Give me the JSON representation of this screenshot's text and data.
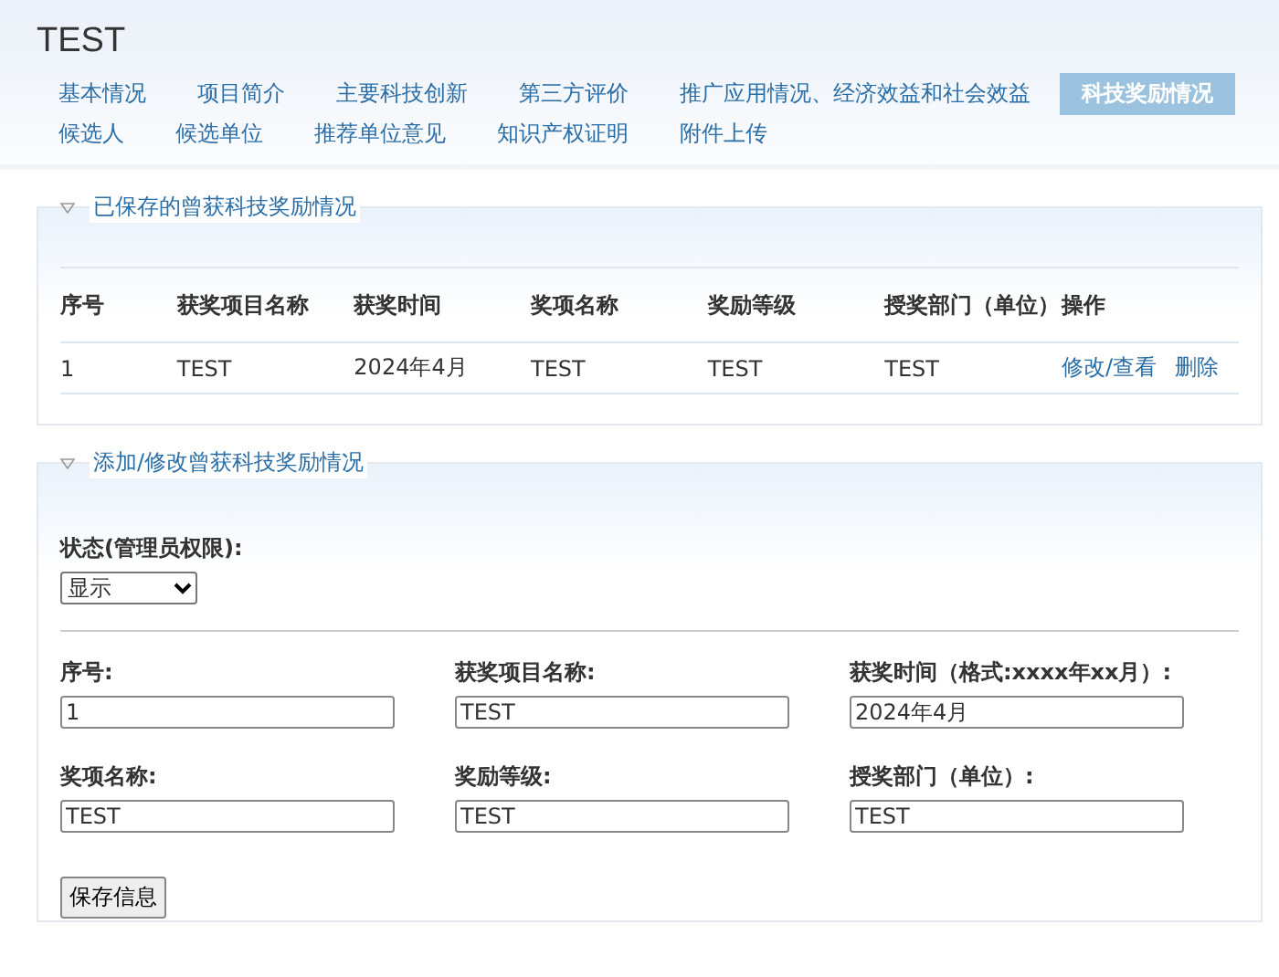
{
  "title": "TEST",
  "tabs": [
    [
      {
        "label": "基本情况",
        "selected": false
      },
      {
        "label": "项目简介",
        "selected": false
      },
      {
        "label": "主要科技创新",
        "selected": false
      },
      {
        "label": "第三方评价",
        "selected": false
      },
      {
        "label": "推广应用情况、经济效益和社会效益",
        "selected": false
      },
      {
        "label": "科技奖励情况",
        "selected": true
      }
    ],
    [
      {
        "label": "候选人",
        "selected": false
      },
      {
        "label": "候选单位",
        "selected": false
      },
      {
        "label": "推荐单位意见",
        "selected": false
      },
      {
        "label": "知识产权证明",
        "selected": false
      },
      {
        "label": "附件上传",
        "selected": false
      }
    ]
  ],
  "saved_panel": {
    "legend": "已保存的曾获科技奖励情况",
    "columns": [
      "序号",
      "获奖项目名称",
      "获奖时间",
      "奖项名称",
      "奖励等级",
      "授奖部门（单位）",
      "操作"
    ],
    "rows": [
      {
        "cells": [
          "1",
          "TEST",
          "2024年4月",
          "TEST",
          "TEST",
          "TEST"
        ],
        "actions": [
          "修改/查看",
          "删除"
        ]
      }
    ]
  },
  "form_panel": {
    "legend": "添加/修改曾获科技奖励情况",
    "status_label": "状态(管理员权限):",
    "status_value": "显示",
    "fields": [
      {
        "label": "序号:",
        "value": "1"
      },
      {
        "label": "获奖项目名称:",
        "value": "TEST"
      },
      {
        "label": "获奖时间（格式:xxxx年xx月）:",
        "value": "2024年4月"
      },
      {
        "label": "奖项名称:",
        "value": "TEST"
      },
      {
        "label": "奖励等级:",
        "value": "TEST"
      },
      {
        "label": "授奖部门（单位）:",
        "value": "TEST"
      }
    ],
    "button": "保存信息"
  }
}
